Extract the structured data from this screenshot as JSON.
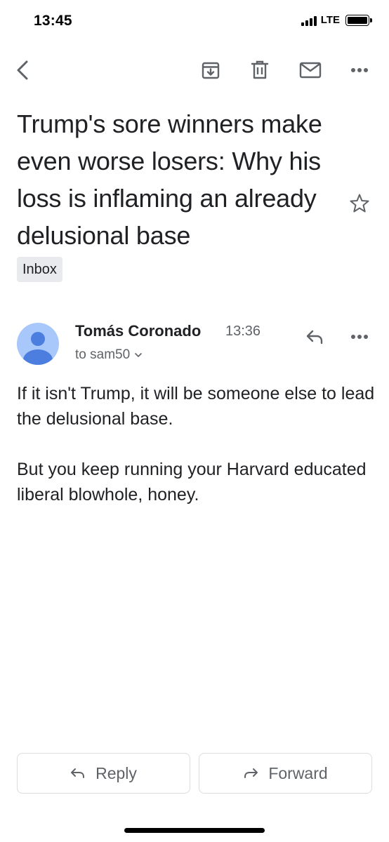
{
  "status_bar": {
    "time": "13:45",
    "network": "LTE"
  },
  "toolbar": {
    "back_icon": "chevron-left-icon",
    "archive_icon": "archive-icon",
    "delete_icon": "trash-icon",
    "mark_unread_icon": "mail-icon",
    "more_icon": "more-horizontal-icon"
  },
  "email": {
    "subject": "Trump's sore winners make even worse losers: Why his loss is inflaming an already delusional base",
    "label": "Inbox",
    "sender": {
      "name": "Tomás Coronado",
      "time": "13:36",
      "recipient": "to sam50"
    },
    "body": [
      "If it isn't Trump, it will be someone else to lead the delusional base.",
      "But you keep running your Harvard educated liberal blowhole, honey."
    ]
  },
  "actions": {
    "reply_label": "Reply",
    "forward_label": "Forward"
  },
  "colors": {
    "icon_gray": "#5f6368",
    "avatar_bg": "#a8c7fa",
    "avatar_fg": "#4c7ee0",
    "chip_bg": "#e8eaed",
    "border": "#dadce0"
  }
}
